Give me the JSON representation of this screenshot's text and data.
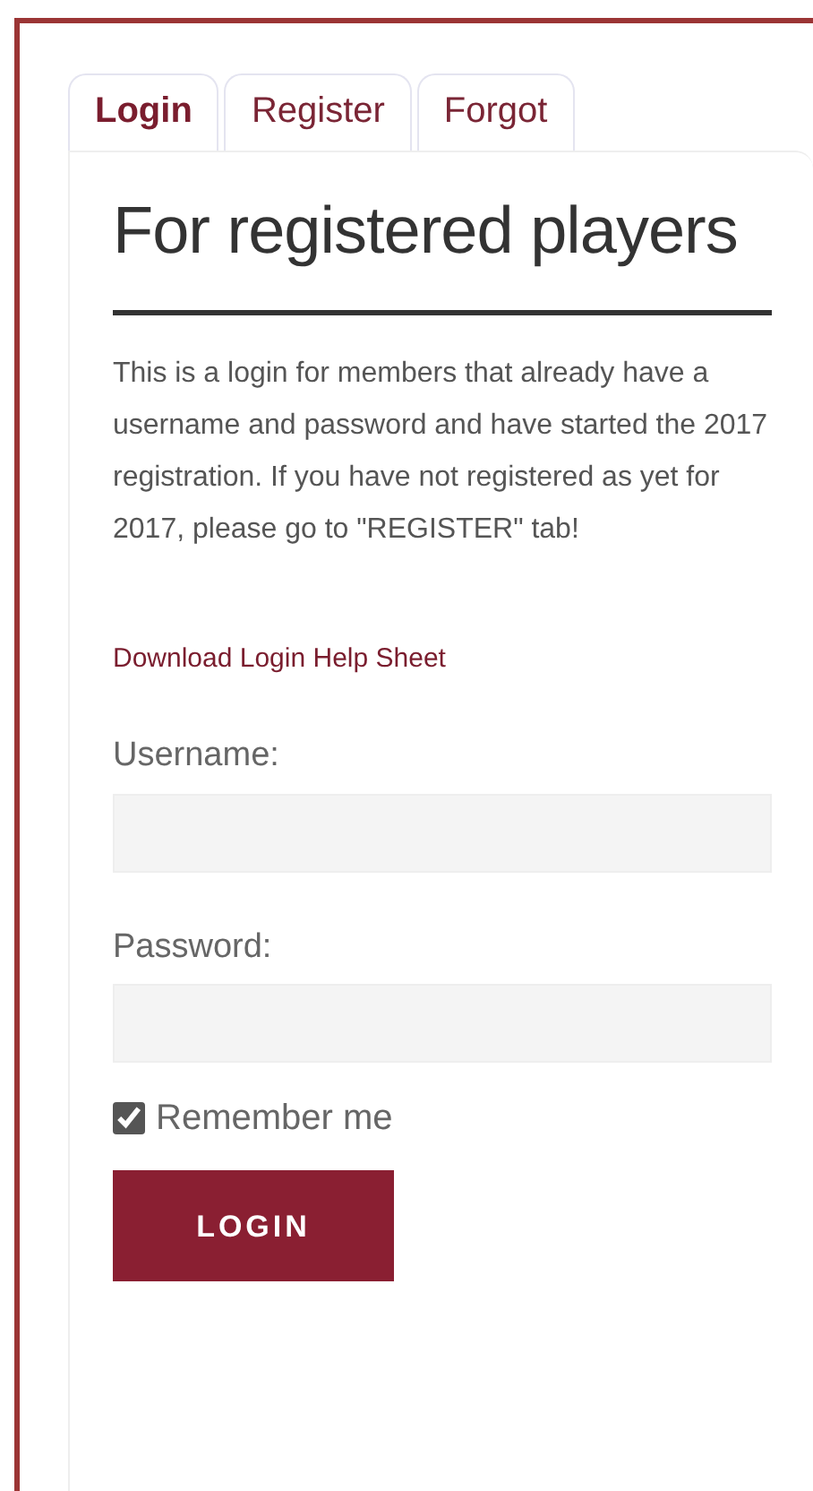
{
  "tabs": [
    {
      "label": "Login",
      "selected": true
    },
    {
      "label": "Register",
      "selected": false
    },
    {
      "label": "Forgot",
      "selected": false
    }
  ],
  "heading": "For registered players",
  "intro": "This is a login for members that already have a username and password and have started the 2017 registration. If you have not registered as yet for 2017, please go to \"REGISTER\" tab!",
  "help_link": "Download Login Help Sheet",
  "fields": [
    {
      "label": "Username:"
    },
    {
      "label": "Password:"
    }
  ],
  "remember": {
    "label": "Remember me",
    "checked": true
  },
  "button": "LOGIN"
}
